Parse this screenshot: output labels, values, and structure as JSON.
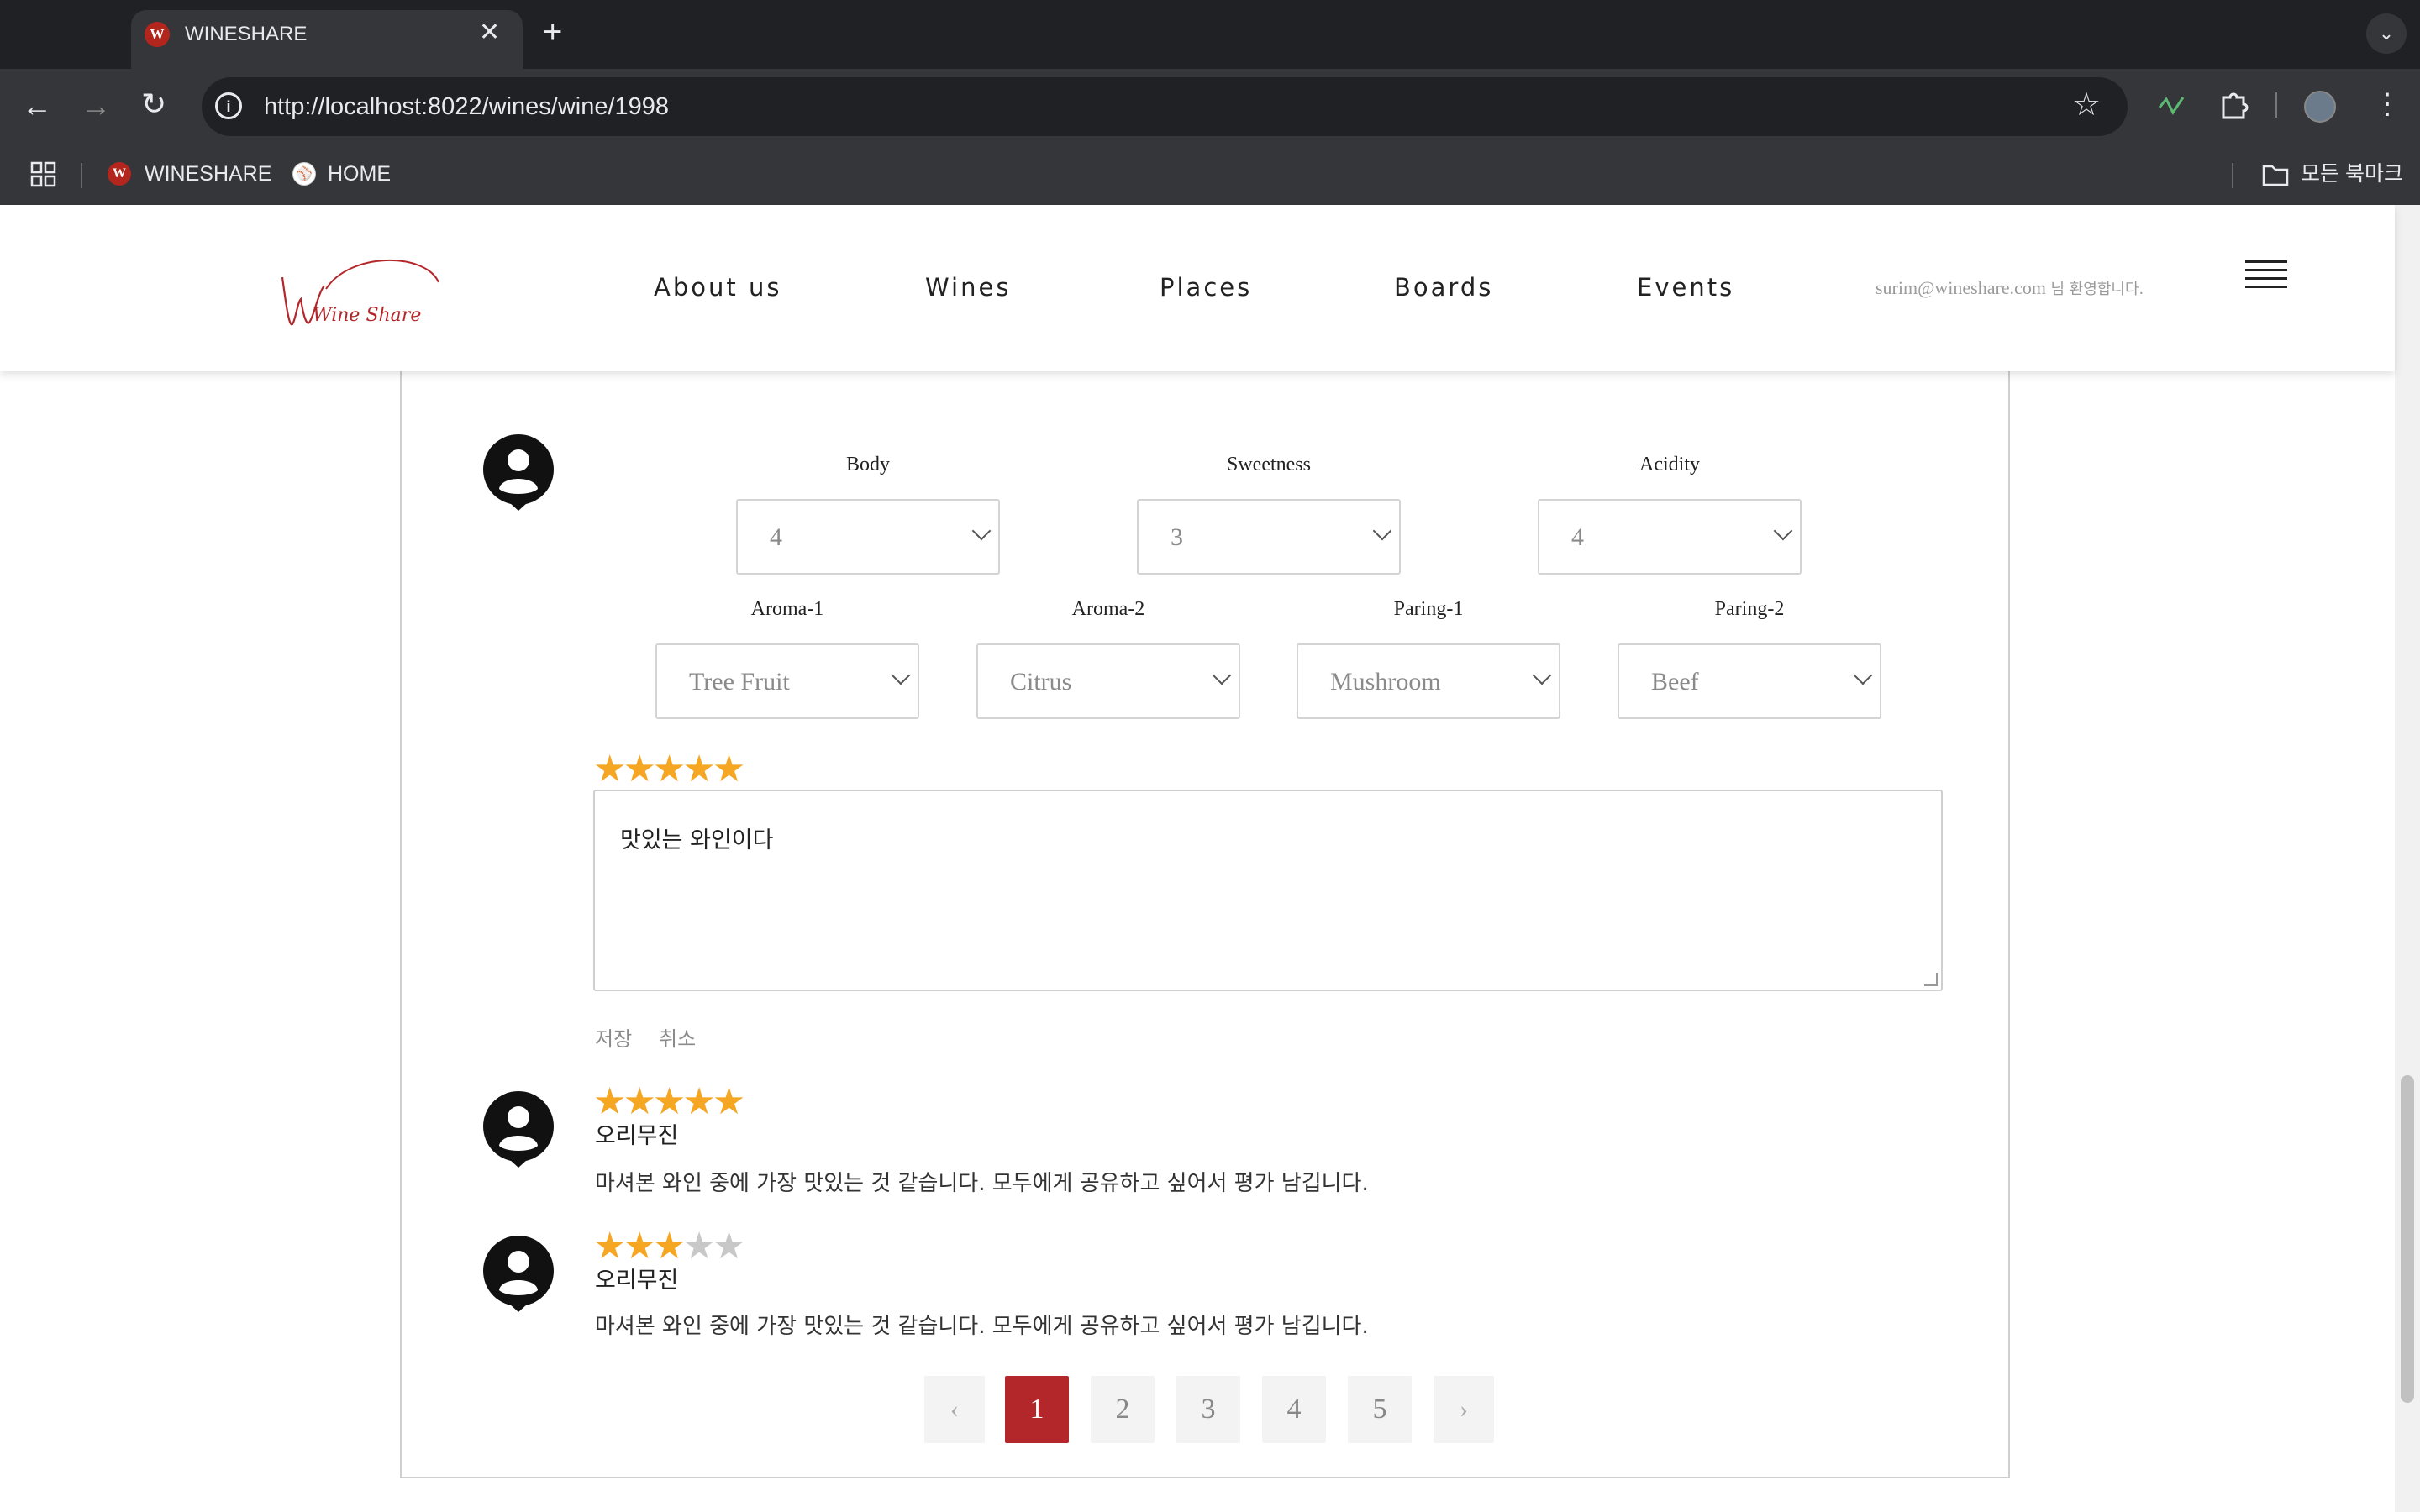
{
  "browser": {
    "tab_title": "WINESHARE",
    "tab_favicon": "W",
    "close_glyph": "✕",
    "newtab_glyph": "+",
    "url": "http://localhost:8022/wines/wine/1998",
    "bookmarks": [
      {
        "label": "WINESHARE"
      },
      {
        "label": "HOME"
      }
    ],
    "all_bookmarks_label": "모든 북마크"
  },
  "site": {
    "logo_text": "Wine Share",
    "logo_color": "#b3262a",
    "nav": [
      "About us",
      "Wines",
      "Places",
      "Boards",
      "Events"
    ],
    "welcome_email": "surim@wineshare.com",
    "welcome_suffix": "님 환영합니다."
  },
  "review_form": {
    "taste": [
      {
        "label": "Body",
        "value": "4"
      },
      {
        "label": "Sweetness",
        "value": "3"
      },
      {
        "label": "Acidity",
        "value": "4"
      }
    ],
    "notes": [
      {
        "label": "Aroma-1",
        "value": "Tree Fruit"
      },
      {
        "label": "Aroma-2",
        "value": "Citrus"
      },
      {
        "label": "Paring-1",
        "value": "Mushroom"
      },
      {
        "label": "Paring-2",
        "value": "Beef"
      }
    ],
    "rating": 5,
    "comment": "맛있는 와인이다",
    "save_label": "저장",
    "cancel_label": "취소"
  },
  "reviews": [
    {
      "rating": 5,
      "author": "오리무진",
      "text": "마셔본 와인 중에 가장 맛있는 것 같습니다. 모두에게 공유하고 싶어서 평가 남깁니다."
    },
    {
      "rating": 3,
      "author": "오리무진",
      "text": "마셔본 와인 중에 가장 맛있는 것 같습니다. 모두에게 공유하고 싶어서 평가 남깁니다."
    }
  ],
  "pagination": {
    "prev": "‹",
    "next": "›",
    "pages": [
      "1",
      "2",
      "3",
      "4",
      "5"
    ],
    "current": "1"
  },
  "colors": {
    "accent": "#b3262a",
    "star": "#f5a623",
    "star_off": "#c8c8c8"
  },
  "icons": [
    "back-icon",
    "forward-icon",
    "reload-icon",
    "info-icon",
    "bookmark-star-icon",
    "extension-icon",
    "puzzle-icon",
    "apps-grid-icon",
    "folder-icon",
    "user-avatar-icon",
    "hamburger-menu-icon"
  ]
}
